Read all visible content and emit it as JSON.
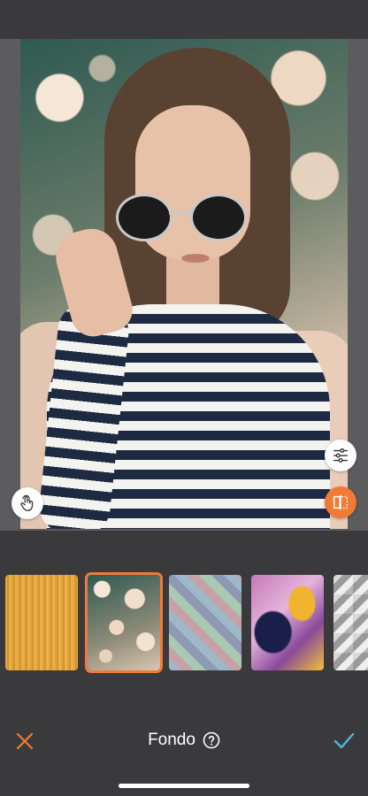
{
  "screen": {
    "title": "Fondo",
    "icons": {
      "help": "question-circle-icon",
      "close": "close-x-icon",
      "confirm": "checkmark-icon",
      "touch": "hand-touch-icon",
      "adjust": "sliders-icon",
      "flip": "flip-horizontal-icon"
    },
    "colors": {
      "accent": "#f07a36",
      "confirm": "#4fb6e6",
      "background": "#3a3a3c"
    }
  },
  "backgrounds": {
    "selected_index": 1,
    "items": [
      {
        "name": "gold-texture-thumbnail"
      },
      {
        "name": "bokeh-thumbnail"
      },
      {
        "name": "pastel-scales-thumbnail"
      },
      {
        "name": "purple-marble-thumbnail"
      },
      {
        "name": "geometric-cubes-thumbnail"
      }
    ]
  }
}
